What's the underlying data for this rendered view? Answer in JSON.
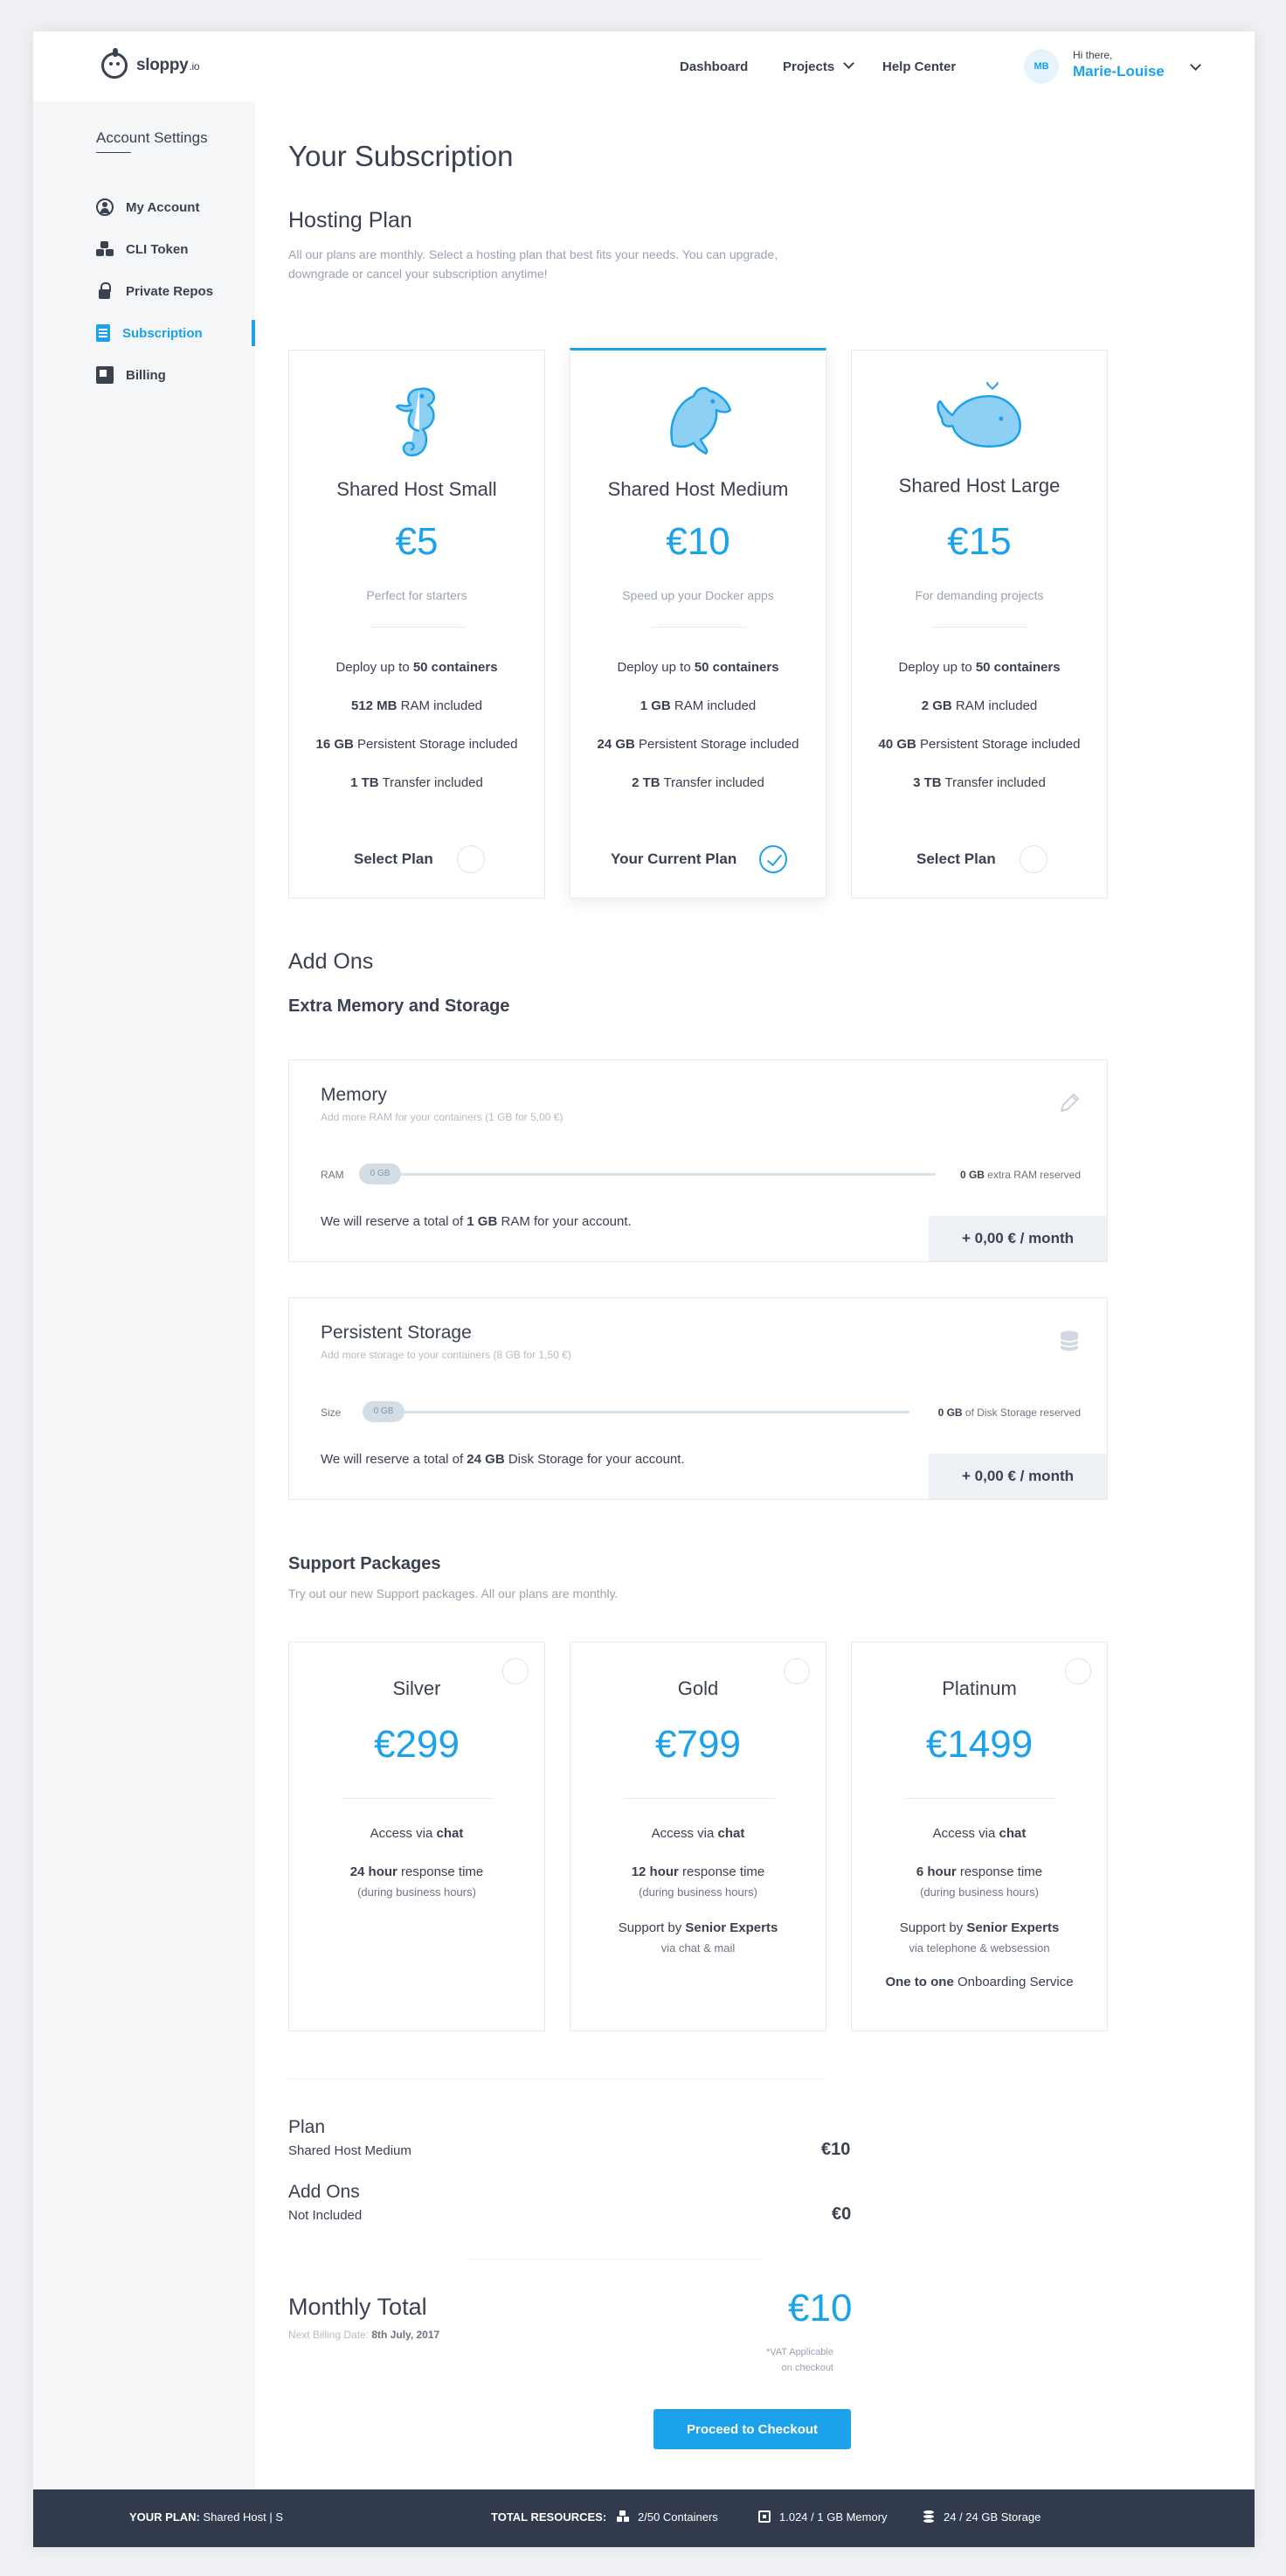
{
  "header": {
    "logo_text": "sloppy",
    "logo_suffix": ".io",
    "nav": [
      {
        "label": "Dashboard"
      },
      {
        "label": "Projects"
      },
      {
        "label": "Help Center"
      }
    ],
    "user": {
      "initials": "MB",
      "greeting": "Hi there,",
      "name": "Marie-Louise"
    }
  },
  "sidebar": {
    "title": "Account Settings",
    "items": [
      {
        "label": "My Account",
        "icon": "user-icon"
      },
      {
        "label": "CLI Token",
        "icon": "cubes-icon"
      },
      {
        "label": "Private Repos",
        "icon": "lock-icon"
      },
      {
        "label": "Subscription",
        "icon": "document-icon",
        "active": true
      },
      {
        "label": "Billing",
        "icon": "billing-icon"
      }
    ]
  },
  "main": {
    "title": "Your Subscription",
    "hosting": {
      "heading": "Hosting Plan",
      "description_line1": "All our plans are monthly. Select a hosting plan that best fits your needs. You can upgrade,",
      "description_line2": "downgrade or cancel your subscription anytime!",
      "plans": [
        {
          "icon": "seahorse-icon",
          "name": "Shared Host Small",
          "price": "€5",
          "tagline": "Perfect for starters",
          "f1_pre": "Deploy up to ",
          "f1_b": "50 containers",
          "f1_post": "",
          "f2_b": "512 MB",
          "f2_post": " RAM included",
          "f3_b": "16 GB",
          "f3_post": " Persistent Storage included",
          "f4_b": "1 TB",
          "f4_post": " Transfer included",
          "action": "Select Plan",
          "selected": false
        },
        {
          "icon": "dolphin-icon",
          "name": "Shared Host Medium",
          "price": "€10",
          "tagline": "Speed up your Docker apps",
          "f1_pre": "Deploy up to ",
          "f1_b": "50 containers",
          "f1_post": "",
          "f2_b": "1 GB",
          "f2_post": " RAM included",
          "f3_b": "24 GB",
          "f3_post": " Persistent Storage included",
          "f4_b": "2 TB",
          "f4_post": " Transfer included",
          "action": "Your Current Plan",
          "selected": true
        },
        {
          "icon": "whale-icon",
          "name": "Shared Host Large",
          "price": "€15",
          "tagline": "For demanding projects",
          "f1_pre": "Deploy up to ",
          "f1_b": "50 containers",
          "f1_post": "",
          "f2_b": "2 GB",
          "f2_post": " RAM included",
          "f3_b": "40 GB",
          "f3_post": " Persistent Storage included",
          "f4_b": "3 TB",
          "f4_post": " Transfer included",
          "action": "Select Plan",
          "selected": false
        }
      ]
    },
    "addons": {
      "heading": "Add Ons",
      "subheading": "Extra Memory and Storage",
      "memory": {
        "title": "Memory",
        "subtitle": "Add more RAM for your containers (1 GB for 5,00 €)",
        "icon": "pencil-icon",
        "slider_label": "RAM",
        "slider_value": "0 GB",
        "reserved_b": "0 GB",
        "reserved_post": " extra RAM reserved",
        "note_pre": "We will reserve a total of ",
        "note_b": "1 GB",
        "note_post": " RAM for your account.",
        "price": "+ 0,00 € / month"
      },
      "storage": {
        "title": "Persistent Storage",
        "subtitle": "Add more storage to your containers (8 GB for 1,50 €)",
        "icon": "database-icon",
        "slider_label": "Size",
        "slider_value": "0 GB",
        "reserved_b": "0 GB",
        "reserved_post": " of Disk Storage reserved",
        "note_pre": "We will reserve a total of ",
        "note_b": "24 GB",
        "note_post": " Disk Storage for your account.",
        "price": "+ 0,00 € / month"
      }
    },
    "support": {
      "heading": "Support Packages",
      "description": "Try out our new Support packages. All our plans are monthly.",
      "packages": [
        {
          "name": "Silver",
          "price": "€299",
          "access_b": "chat",
          "response_b": "24 hour"
        },
        {
          "name": "Gold",
          "price": "€799",
          "access_b": "chat",
          "response_b": "12 hour",
          "support_b": "Senior Experts",
          "support_via": "via chat & mail"
        },
        {
          "name": "Platinum",
          "price": "€1499",
          "access_b": "chat",
          "response_b": "6 hour",
          "support_b": "Senior Experts",
          "support_via": "via telephone & websession",
          "extra_b": "One to one",
          "extra_post": " Onboarding Service"
        }
      ],
      "access_pre": "Access via ",
      "response_post": " response time",
      "hours_note": "(during business hours)",
      "support_pre": "Support by "
    },
    "summary": {
      "plan_label": "Plan",
      "plan_value": "Shared Host Medium",
      "plan_price": "€10",
      "addons_label": "Add Ons",
      "addons_value": "Not Included",
      "addons_price": "€0",
      "total_label": "Monthly Total",
      "billing_pre": "Next Billing Date: ",
      "billing_date": "8th July, 2017",
      "total_price": "€10",
      "vat_line1": "*VAT Applicable",
      "vat_line2": "on checkout",
      "checkout": "Proceed to Checkout"
    }
  },
  "footer": {
    "plan_label": "YOUR PLAN:",
    "plan_value": " Shared Host | S",
    "resources_label": "TOTAL RESOURCES:",
    "containers": "2/50 Containers",
    "memory": "1.024 / 1 GB Memory",
    "storage": "24 / 24 GB Storage"
  },
  "colors": {
    "accent": "#1ba2ea",
    "text": "#3a4150",
    "footer_bg": "#323b4e",
    "sidebar_bg": "#f5f6f8"
  }
}
